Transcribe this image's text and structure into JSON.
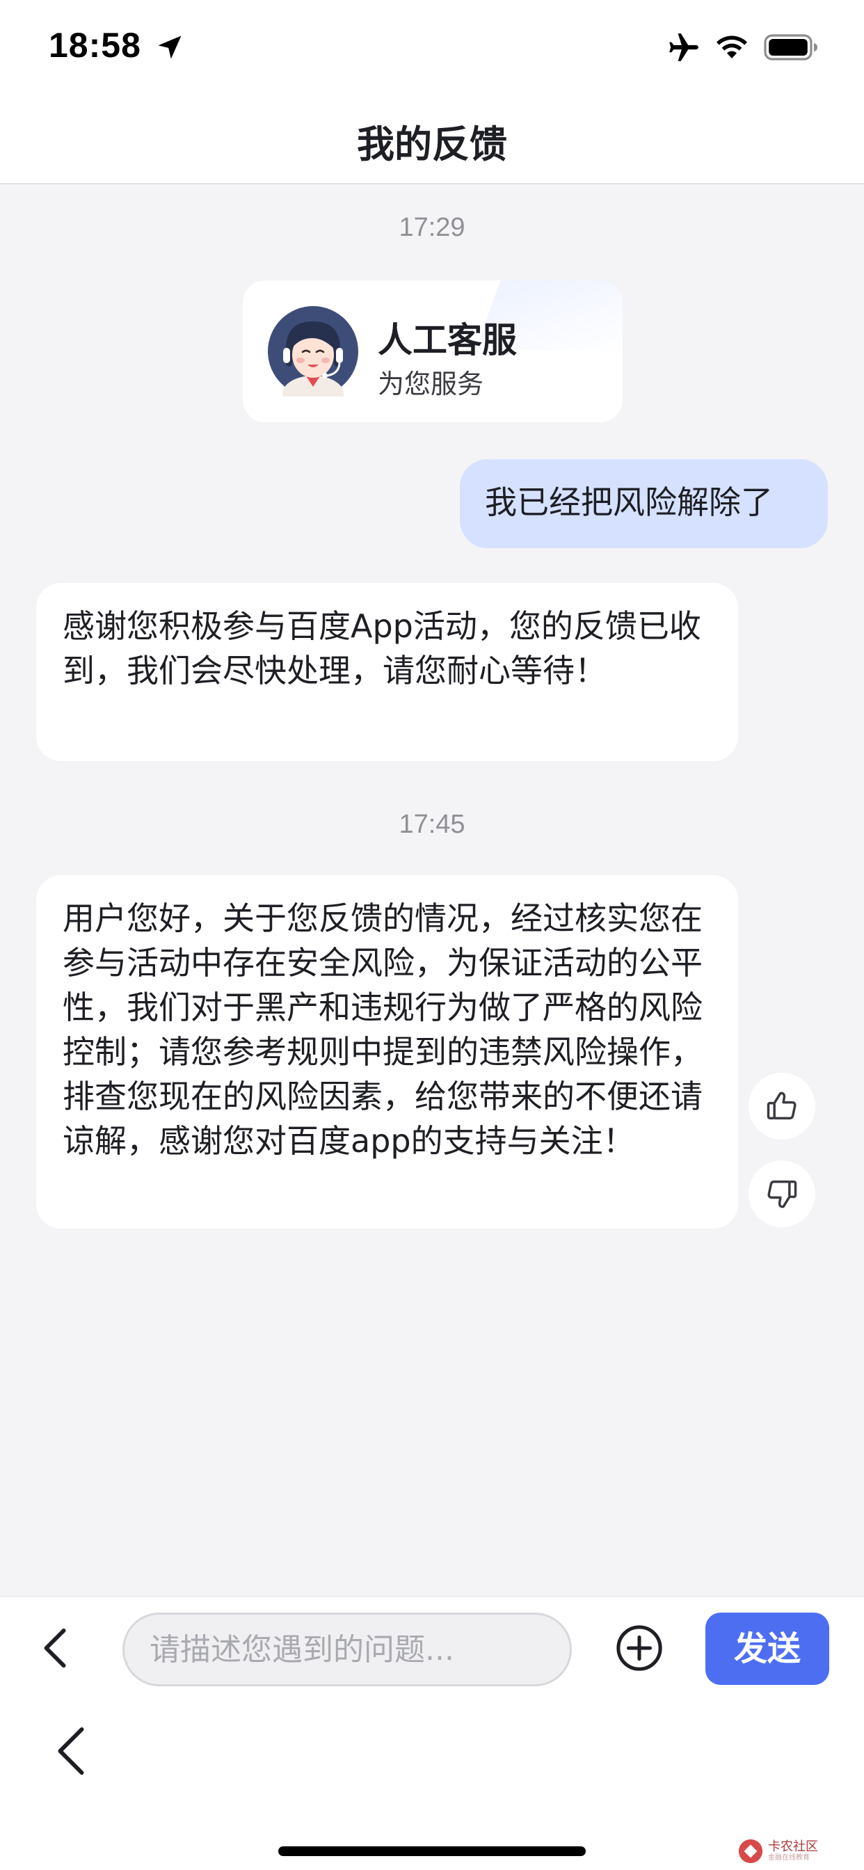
{
  "status_bar": {
    "time": "18:58",
    "icons": [
      "location-arrow-icon",
      "airplane-icon",
      "wifi-icon",
      "battery-icon"
    ]
  },
  "header": {
    "title": "我的反馈"
  },
  "chat": {
    "timestamps": [
      "17:29",
      "17:45"
    ],
    "agent_card": {
      "name": "人工客服",
      "subtitle": "为您服务"
    },
    "messages": [
      {
        "from": "user",
        "text": "我已经把风险解除了"
      },
      {
        "from": "agent",
        "text": "感谢您积极参与百度App活动，您的反馈已收到，我们会尽快处理，请您耐心等待！"
      },
      {
        "from": "agent",
        "text": "用户您好，关于您反馈的情况，经过核实您在参与活动中存在安全风险，为保证活动的公平性，我们对于黑产和违规行为做了严格的风险控制；请您参考规则中提到的违禁风险操作，排查您现在的风险因素，给您带来的不便还请谅解，感谢您对百度app的支持与关注！"
      }
    ]
  },
  "input_bar": {
    "placeholder": "请描述您遇到的问题...",
    "value": "",
    "send_label": "发送"
  },
  "watermark": {
    "text": "卡农社区",
    "sub": "金融在线教育"
  },
  "colors": {
    "accent": "#4e6ef2",
    "user_bubble": "#d5e1ff",
    "chat_background": "#f4f4f6"
  }
}
